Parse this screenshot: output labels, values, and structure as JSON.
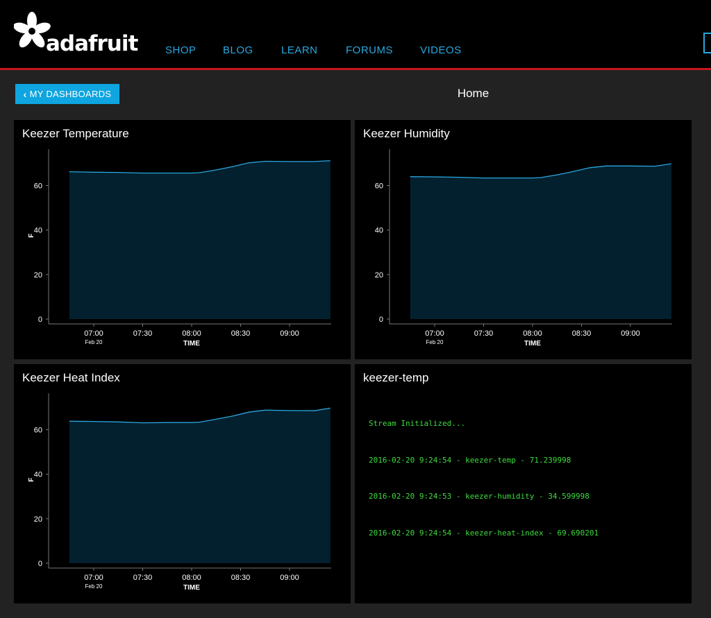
{
  "brand": {
    "name": "adafruit"
  },
  "nav": {
    "items": [
      "SHOP",
      "BLOG",
      "LEARN",
      "FORUMS",
      "VIDEOS"
    ]
  },
  "toolbar": {
    "dashboards_label": "MY DASHBOARDS"
  },
  "page": {
    "title": "Home"
  },
  "colors": {
    "accent": "#2aa7e0",
    "header_bar": "#c8161d",
    "area_fill": "#03202f",
    "line": "#2aa7e0",
    "log_text": "#3ddc3d"
  },
  "icons": {
    "back": "chevron-left-icon",
    "logo": "adafruit-flower-icon"
  },
  "panels": [
    {
      "title": "Keezer Temperature",
      "ylabel": "F",
      "xlabel": "TIME",
      "date_label": "Feb 20"
    },
    {
      "title": "Keezer Humidity",
      "ylabel": "",
      "xlabel": "TIME",
      "date_label": "Feb 20"
    },
    {
      "title": "Keezer Heat Index",
      "ylabel": "F",
      "xlabel": "TIME",
      "date_label": "Feb 20"
    }
  ],
  "stream": {
    "title": "keezer-temp",
    "lines": [
      "Stream Initialized...",
      "2016-02-20 9:24:54 - keezer-temp - 71.239998",
      "2016-02-20 9:24:53 - keezer-humidity - 34.599998",
      "2016-02-20 9:24:54 - keezer-heat-index - 69.690201"
    ]
  },
  "chart_data": [
    {
      "type": "area",
      "title": "Keezer Temperature",
      "xlabel": "TIME",
      "ylabel": "F",
      "ylim": [
        0,
        72
      ],
      "yticks": [
        0,
        20,
        40,
        60
      ],
      "xticks": [
        "07:00",
        "07:30",
        "08:00",
        "08:30",
        "09:00"
      ],
      "x": [
        "06:45",
        "07:00",
        "07:15",
        "07:30",
        "07:45",
        "08:00",
        "08:05",
        "08:15",
        "08:25",
        "08:35",
        "08:45",
        "09:00",
        "09:15",
        "09:25"
      ],
      "values": [
        66.2,
        66.0,
        65.9,
        65.6,
        65.6,
        65.6,
        65.8,
        67.0,
        68.5,
        70.2,
        70.9,
        70.8,
        70.8,
        71.2
      ]
    },
    {
      "type": "area",
      "title": "Keezer Humidity",
      "xlabel": "TIME",
      "ylabel": "",
      "ylim": [
        0,
        72
      ],
      "yticks": [
        0,
        20,
        40,
        60
      ],
      "xticks": [
        "07:00",
        "07:30",
        "08:00",
        "08:30",
        "09:00"
      ],
      "x": [
        "06:45",
        "07:00",
        "07:15",
        "07:30",
        "07:45",
        "08:00",
        "08:05",
        "08:15",
        "08:25",
        "08:35",
        "08:45",
        "09:00",
        "09:15",
        "09:25"
      ],
      "values": [
        64.0,
        63.9,
        63.7,
        63.4,
        63.4,
        63.4,
        63.6,
        64.8,
        66.3,
        68.0,
        68.8,
        68.8,
        68.7,
        69.8
      ]
    },
    {
      "type": "area",
      "title": "Keezer Heat Index",
      "xlabel": "TIME",
      "ylabel": "F",
      "ylim": [
        0,
        72
      ],
      "yticks": [
        0,
        20,
        40,
        60
      ],
      "xticks": [
        "07:00",
        "07:30",
        "08:00",
        "08:30",
        "09:00"
      ],
      "x": [
        "06:45",
        "07:00",
        "07:15",
        "07:30",
        "07:45",
        "08:00",
        "08:05",
        "08:15",
        "08:25",
        "08:35",
        "08:45",
        "09:00",
        "09:15",
        "09:25"
      ],
      "values": [
        63.8,
        63.7,
        63.5,
        63.1,
        63.2,
        63.2,
        63.4,
        64.7,
        66.1,
        67.9,
        68.8,
        68.6,
        68.5,
        69.7
      ]
    }
  ]
}
